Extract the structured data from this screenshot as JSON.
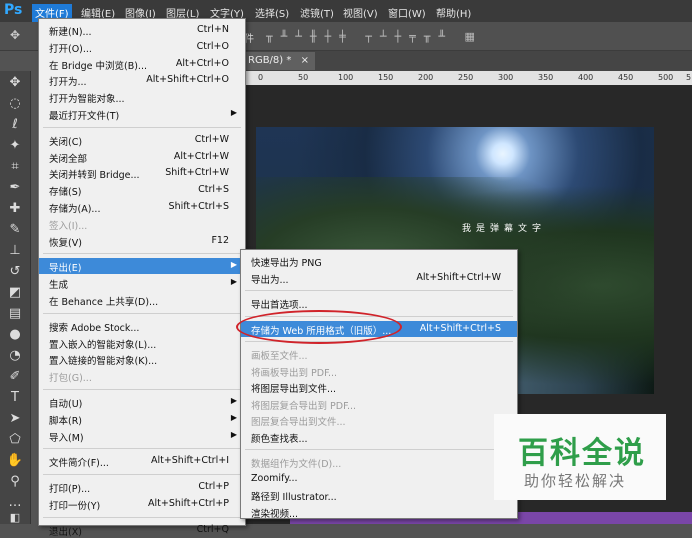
{
  "app": {
    "logo": "Ps"
  },
  "menubar": [
    "文件(F)",
    "编辑(E)",
    "图像(I)",
    "图层(L)",
    "文字(Y)",
    "选择(S)",
    "滤镜(T)",
    "视图(V)",
    "窗口(W)",
    "帮助(H)"
  ],
  "optbar": {
    "partial_label": "件"
  },
  "document_tab": {
    "label": "RGB/8) *",
    "close": "×"
  },
  "ruler": [
    "0",
    "50",
    "100",
    "150",
    "200",
    "250",
    "300",
    "350",
    "400",
    "450",
    "500",
    "5"
  ],
  "canvas": {
    "caption": "我是弹幕文字"
  },
  "file_menu": [
    {
      "label": "新建(N)...",
      "shortcut": "Ctrl+N"
    },
    {
      "label": "打开(O)...",
      "shortcut": "Ctrl+O"
    },
    {
      "label": "在 Bridge 中浏览(B)...",
      "shortcut": "Alt+Ctrl+O"
    },
    {
      "label": "打开为...",
      "shortcut": "Alt+Shift+Ctrl+O"
    },
    {
      "label": "打开为智能对象...",
      "shortcut": ""
    },
    {
      "label": "最近打开文件(T)",
      "shortcut": "",
      "submenu": true
    },
    {
      "sep": true
    },
    {
      "label": "关闭(C)",
      "shortcut": "Ctrl+W"
    },
    {
      "label": "关闭全部",
      "shortcut": "Alt+Ctrl+W"
    },
    {
      "label": "关闭并转到 Bridge...",
      "shortcut": "Shift+Ctrl+W"
    },
    {
      "label": "存储(S)",
      "shortcut": "Ctrl+S"
    },
    {
      "label": "存储为(A)...",
      "shortcut": "Shift+Ctrl+S"
    },
    {
      "label": "签入(I)...",
      "shortcut": "",
      "disabled": true
    },
    {
      "label": "恢复(V)",
      "shortcut": "F12"
    },
    {
      "sep": true
    },
    {
      "label": "导出(E)",
      "shortcut": "",
      "submenu": true,
      "highlight": true
    },
    {
      "label": "生成",
      "shortcut": "",
      "submenu": true
    },
    {
      "label": "在 Behance 上共享(D)...",
      "shortcut": ""
    },
    {
      "sep": true
    },
    {
      "label": "搜索 Adobe Stock...",
      "shortcut": ""
    },
    {
      "label": "置入嵌入的智能对象(L)...",
      "shortcut": ""
    },
    {
      "label": "置入链接的智能对象(K)...",
      "shortcut": ""
    },
    {
      "label": "打包(G)...",
      "shortcut": "",
      "disabled": true
    },
    {
      "sep": true
    },
    {
      "label": "自动(U)",
      "shortcut": "",
      "submenu": true
    },
    {
      "label": "脚本(R)",
      "shortcut": "",
      "submenu": true
    },
    {
      "label": "导入(M)",
      "shortcut": "",
      "submenu": true
    },
    {
      "sep": true
    },
    {
      "label": "文件简介(F)...",
      "shortcut": "Alt+Shift+Ctrl+I"
    },
    {
      "sep": true
    },
    {
      "label": "打印(P)...",
      "shortcut": "Ctrl+P"
    },
    {
      "label": "打印一份(Y)",
      "shortcut": "Alt+Shift+Ctrl+P"
    },
    {
      "sep": true
    },
    {
      "label": "退出(X)",
      "shortcut": "Ctrl+Q"
    }
  ],
  "export_submenu": [
    {
      "label": "快速导出为 PNG",
      "shortcut": ""
    },
    {
      "label": "导出为...",
      "shortcut": "Alt+Shift+Ctrl+W"
    },
    {
      "sep": true
    },
    {
      "label": "导出首选项...",
      "shortcut": ""
    },
    {
      "sep": true
    },
    {
      "label": "存储为 Web 所用格式（旧版）...",
      "shortcut": "Alt+Shift+Ctrl+S",
      "highlight": true
    },
    {
      "sep": true
    },
    {
      "label": "画板至文件...",
      "shortcut": "",
      "disabled": true
    },
    {
      "label": "将画板导出到 PDF...",
      "shortcut": "",
      "disabled": true
    },
    {
      "label": "将图层导出到文件...",
      "shortcut": ""
    },
    {
      "label": "将图层复合导出到 PDF...",
      "shortcut": "",
      "disabled": true
    },
    {
      "label": "图层复合导出到文件...",
      "shortcut": "",
      "disabled": true
    },
    {
      "label": "颜色查找表...",
      "shortcut": ""
    },
    {
      "sep": true
    },
    {
      "label": "数据组作为文件(D)...",
      "shortcut": "",
      "disabled": true
    },
    {
      "label": "Zoomify...",
      "shortcut": ""
    },
    {
      "label": "路径到 Illustrator...",
      "shortcut": ""
    },
    {
      "label": "渲染视频...",
      "shortcut": ""
    }
  ],
  "watermark": {
    "title": "百科全说",
    "subtitle": "助你轻松解决"
  },
  "colors": {
    "highlight": "#3d8ad9",
    "annotation": "#d0232a",
    "watermark_green": "#2f9e4a",
    "ps_blue": "#31a8ff"
  }
}
